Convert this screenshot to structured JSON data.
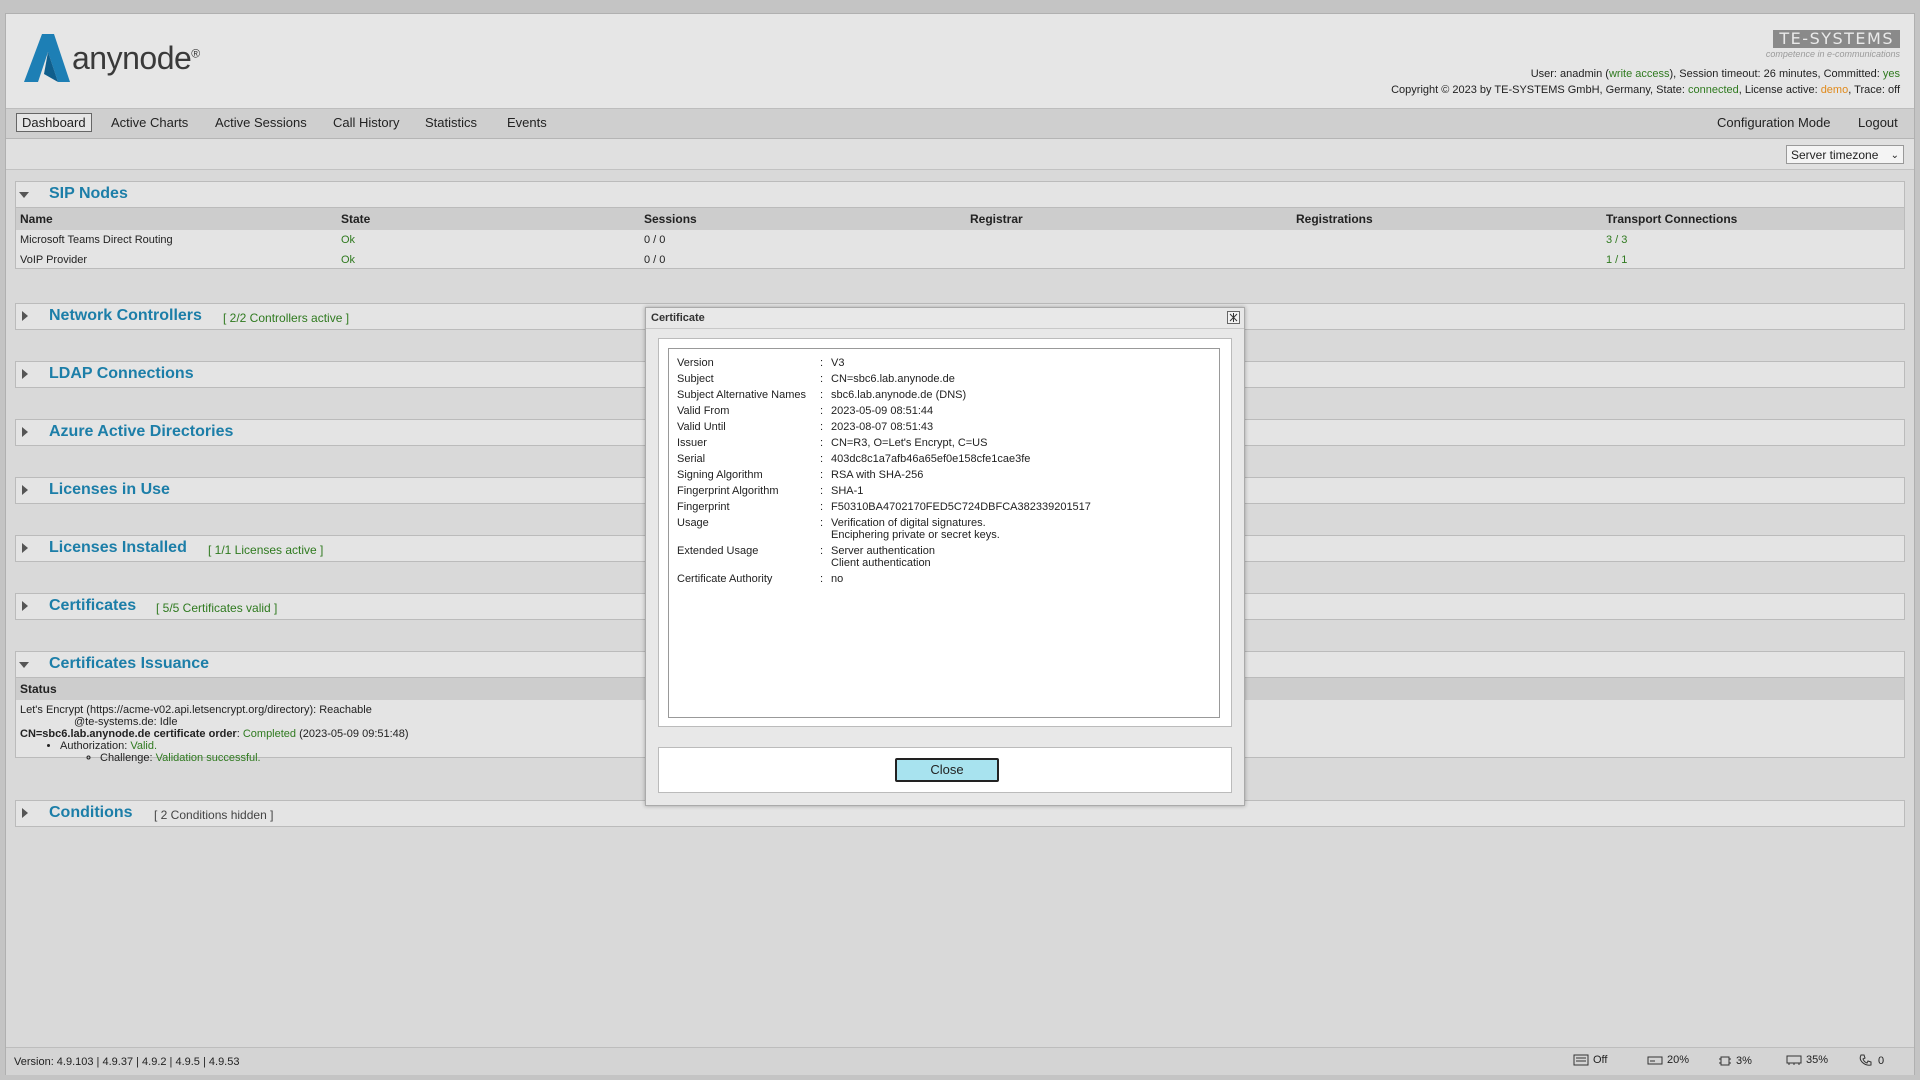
{
  "header": {
    "brand": "anynode",
    "brand_mark": "®",
    "te_logo": "TE-SYSTEMS",
    "te_tagline": "competence in e-communications",
    "line1": {
      "user_label": "User: anadmin (",
      "access": "write access",
      "rest": "), Session timeout: 26 minutes, Committed: ",
      "committed": "yes"
    },
    "line2": {
      "copyright": "Copyright © 2023 by TE-SYSTEMS GmbH, Germany, State: ",
      "state": "connected",
      "license_label": ", License active: ",
      "license": "demo",
      "trace_label": ", Trace: ",
      "trace": "off"
    }
  },
  "nav": {
    "items": [
      "Dashboard",
      "Active Charts",
      "Active Sessions",
      "Call History",
      "Statistics",
      "Events"
    ],
    "config_mode": "Configuration Mode",
    "logout": "Logout"
  },
  "timezone": {
    "selected": "Server timezone"
  },
  "sip_nodes": {
    "title": "SIP Nodes",
    "columns": [
      "Name",
      "State",
      "Sessions",
      "Registrar",
      "Registrations",
      "Transport Connections"
    ],
    "rows": [
      {
        "name": "Microsoft Teams Direct Routing",
        "state": "Ok",
        "sessions": "0 / 0",
        "registrar": "",
        "registrations": "",
        "transport": "3 / 3"
      },
      {
        "name": "VoIP Provider",
        "state": "Ok",
        "sessions": "0 / 0",
        "registrar": "",
        "registrations": "",
        "transport": "1 / 1"
      }
    ]
  },
  "sections": {
    "network": {
      "title": "Network Controllers",
      "badge": "[ 2/2 Controllers active ]"
    },
    "ldap": {
      "title": "LDAP Connections"
    },
    "azure": {
      "title": "Azure Active Directories"
    },
    "lic_use": {
      "title": "Licenses in Use"
    },
    "lic_inst": {
      "title": "Licenses Installed",
      "badge": "[ 1/1 Licenses active ]"
    },
    "certs": {
      "title": "Certificates",
      "badge": "[ 5/5 Certificates valid ]"
    },
    "issuance": {
      "title": "Certificates Issuance",
      "status_header": "Status",
      "line1": "Let's Encrypt (https://acme-v02.api.letsencrypt.org/directory): Reachable",
      "line2": "@te-systems.de: Idle",
      "order_bold": "CN=sbc6.lab.anynode.de certificate order",
      "order_sep": ": ",
      "order_status": "Completed",
      "order_time": " (2023-05-09 09:51:48)",
      "auth_label": "Authorization: ",
      "auth_value": "Valid.",
      "challenge_label": "Challenge: ",
      "challenge_value": "Validation successful."
    },
    "conditions": {
      "title": "Conditions",
      "badge": "[ 2 Conditions hidden ]"
    }
  },
  "footer": {
    "version": "Version:  4.9.103  |  4.9.37  |  4.9.2  |  4.9.5  |  4.9.53",
    "stats": [
      {
        "icon": "keyboard-icon",
        "value": "Off"
      },
      {
        "icon": "disk-icon",
        "value": "20%"
      },
      {
        "icon": "cpu-icon",
        "value": "3%"
      },
      {
        "icon": "memory-icon",
        "value": "35%"
      },
      {
        "icon": "phone-icon",
        "value": "0"
      }
    ]
  },
  "dialog": {
    "title": "Certificate",
    "fields": [
      {
        "key": "Version",
        "value": [
          "V3"
        ]
      },
      {
        "key": "Subject",
        "value": [
          "CN=sbc6.lab.anynode.de"
        ]
      },
      {
        "key": "Subject Alternative Names",
        "value": [
          "sbc6.lab.anynode.de (DNS)"
        ]
      },
      {
        "key": "Valid From",
        "value": [
          "2023-05-09 08:51:44"
        ]
      },
      {
        "key": "Valid Until",
        "value": [
          "2023-08-07 08:51:43"
        ]
      },
      {
        "key": "Issuer",
        "value": [
          "CN=R3, O=Let's Encrypt, C=US"
        ]
      },
      {
        "key": "Serial",
        "value": [
          "403dc8c1a7afb46a65ef0e158cfe1cae3fe"
        ]
      },
      {
        "key": "Signing Algorithm",
        "value": [
          "RSA with SHA-256"
        ]
      },
      {
        "key": "Fingerprint Algorithm",
        "value": [
          "SHA-1"
        ]
      },
      {
        "key": "Fingerprint",
        "value": [
          "F50310BA4702170FED5C724DBFCA382339201517"
        ]
      },
      {
        "key": "Usage",
        "value": [
          "Verification of digital signatures.",
          "Enciphering private or secret keys."
        ]
      },
      {
        "key": "Extended Usage",
        "value": [
          "Server authentication",
          "Client authentication"
        ]
      },
      {
        "key": "Certificate Authority",
        "value": [
          "no"
        ]
      }
    ],
    "close_label": "Close"
  }
}
